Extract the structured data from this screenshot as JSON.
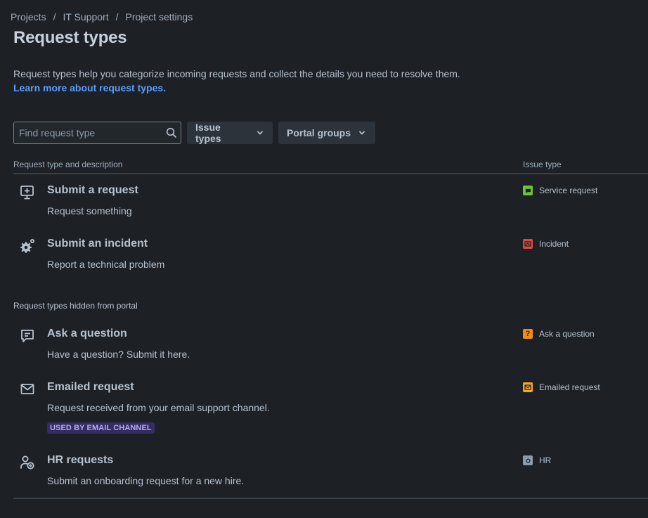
{
  "breadcrumb": {
    "items": [
      "Projects",
      "IT Support",
      "Project settings"
    ],
    "separator": "/"
  },
  "page": {
    "title": "Request types",
    "description": "Request types help you categorize incoming requests and collect the details you need to resolve them.",
    "learn_more": "Learn more about request types."
  },
  "toolbar": {
    "search_placeholder": "Find request type",
    "search_value": "",
    "issue_types_label": "Issue types",
    "portal_groups_label": "Portal groups"
  },
  "table": {
    "col_request": "Request type and description",
    "col_issue": "Issue type"
  },
  "visible_rows": [
    {
      "title": "Submit a request",
      "description": "Request something",
      "icon": "monitor-plus-icon",
      "issue_type": "Service request",
      "issue_color": "#6cc335"
    },
    {
      "title": "Submit an incident",
      "description": "Report a technical problem",
      "icon": "gears-icon",
      "issue_type": "Incident",
      "issue_color": "#e2483d"
    }
  ],
  "hidden_section": {
    "label": "Request types hidden from portal"
  },
  "hidden_rows": [
    {
      "title": "Ask a question",
      "description": "Have a question? Submit it here.",
      "icon": "chat-bubble-icon",
      "issue_type": "Ask a question",
      "issue_color": "#fca700"
    },
    {
      "title": "Emailed request",
      "description": "Request received from your email support channel.",
      "icon": "envelope-icon",
      "issue_type": "Emailed request",
      "issue_color": "#f5a623",
      "lozenge": "USED BY EMAIL CHANNEL"
    },
    {
      "title": "HR requests",
      "description": "Submit an onboarding request for a new hire.",
      "icon": "person-add-icon",
      "issue_type": "HR",
      "issue_color": "#8c9bab"
    }
  ],
  "colors": {
    "background": "#1d2125",
    "link": "#579dff",
    "lozenge_bg": "#352c63",
    "lozenge_text": "#b8acf6"
  }
}
